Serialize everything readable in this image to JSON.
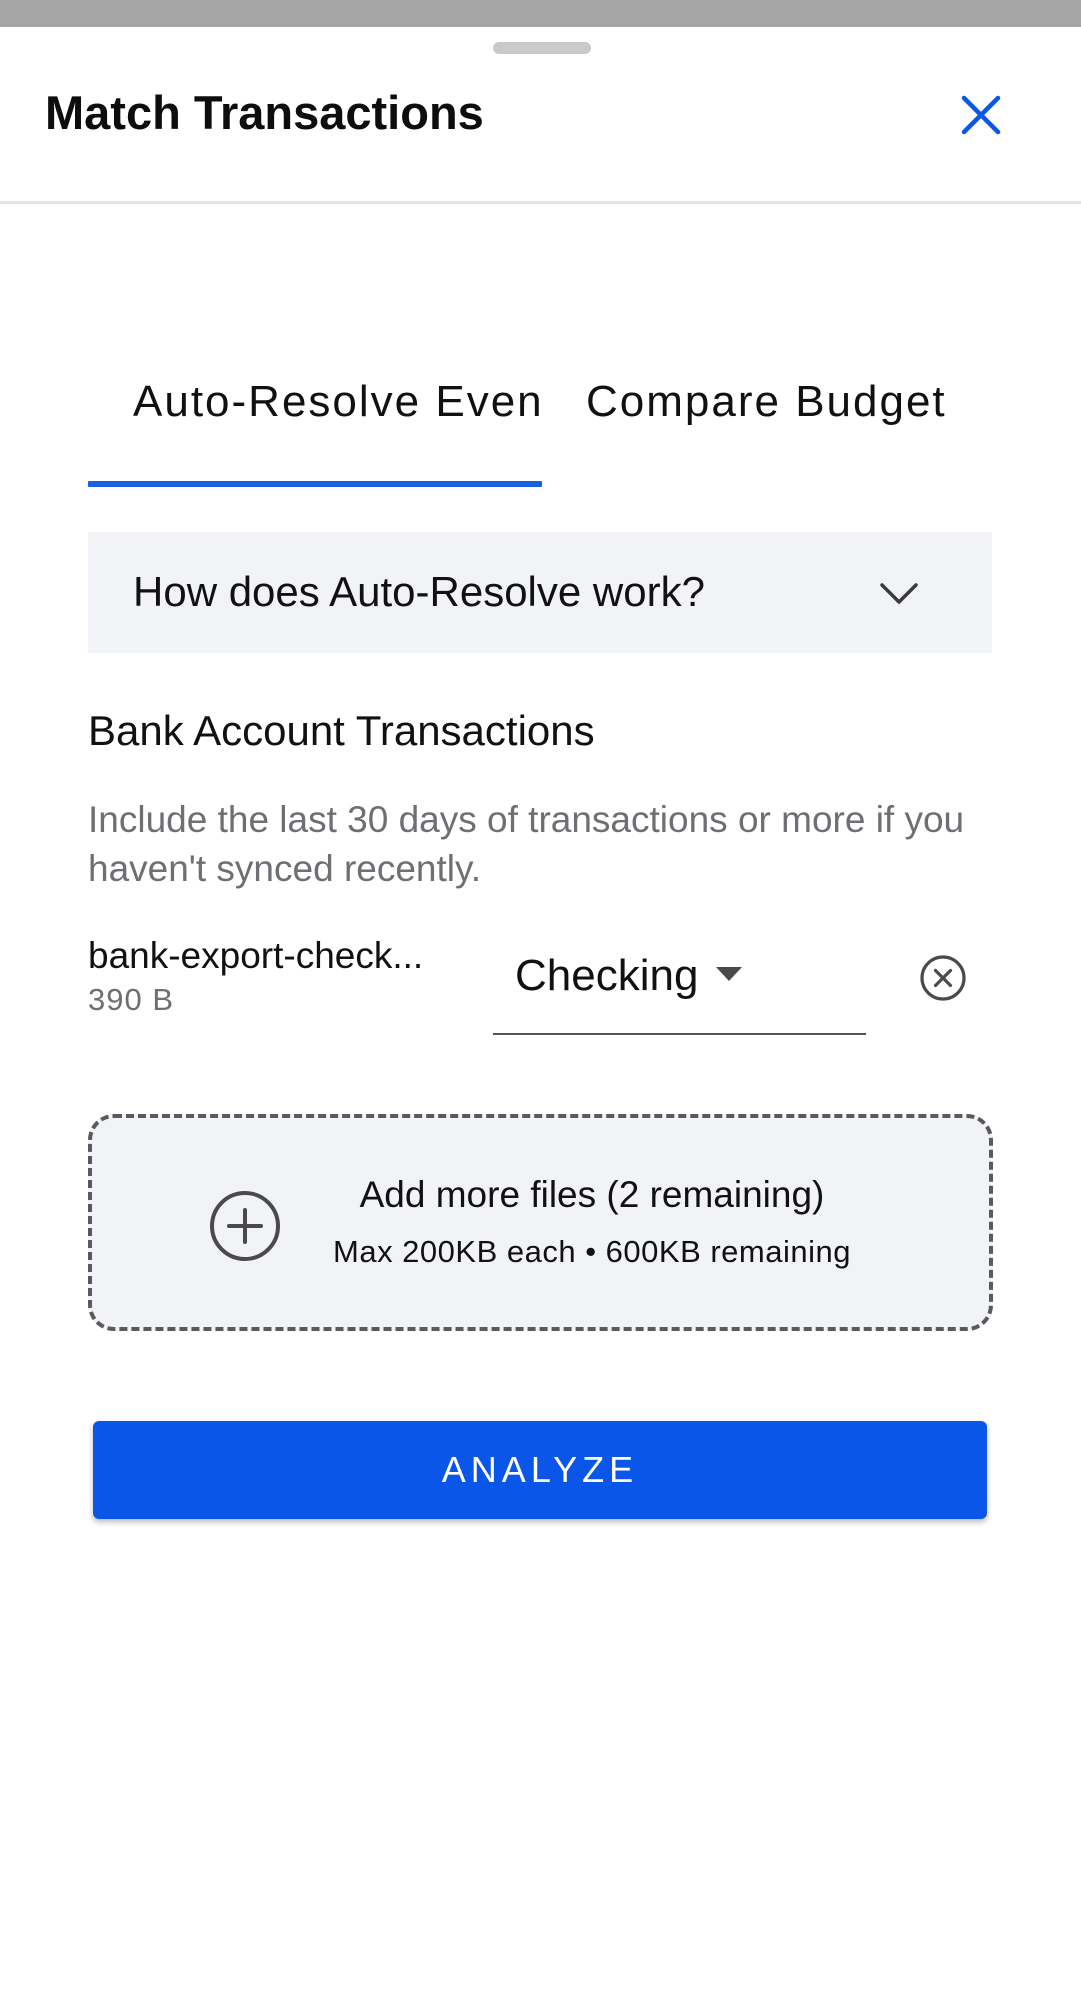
{
  "sheet": {
    "title": "Match Transactions",
    "close_icon": "close-icon"
  },
  "tabs": [
    {
      "label": "Auto-Resolve Even",
      "selected": true
    },
    {
      "label": "Compare Budget",
      "selected": false
    }
  ],
  "accordion": {
    "label": "How does Auto-Resolve work?",
    "expanded": false,
    "icon": "chevron-down-icon"
  },
  "bank_section": {
    "heading": "Bank Account Transactions",
    "description": "Include the last 30 days of transactions or more if you haven't synced recently."
  },
  "file": {
    "name": "bank-export-check...",
    "size": "390 B",
    "account_type": "Checking",
    "remove_icon": "remove-circle-icon"
  },
  "dropzone": {
    "title": "Add more files (2 remaining)",
    "subtitle": "Max 200KB each • 600KB remaining",
    "icon": "add-circle-icon"
  },
  "actions": {
    "analyze_label": "ANALYZE"
  },
  "colors": {
    "accent": "#0a56e8",
    "tab_indicator": "#1a5fe0",
    "panel_bg": "#f2f3f7",
    "muted_text": "#6e6e73"
  }
}
